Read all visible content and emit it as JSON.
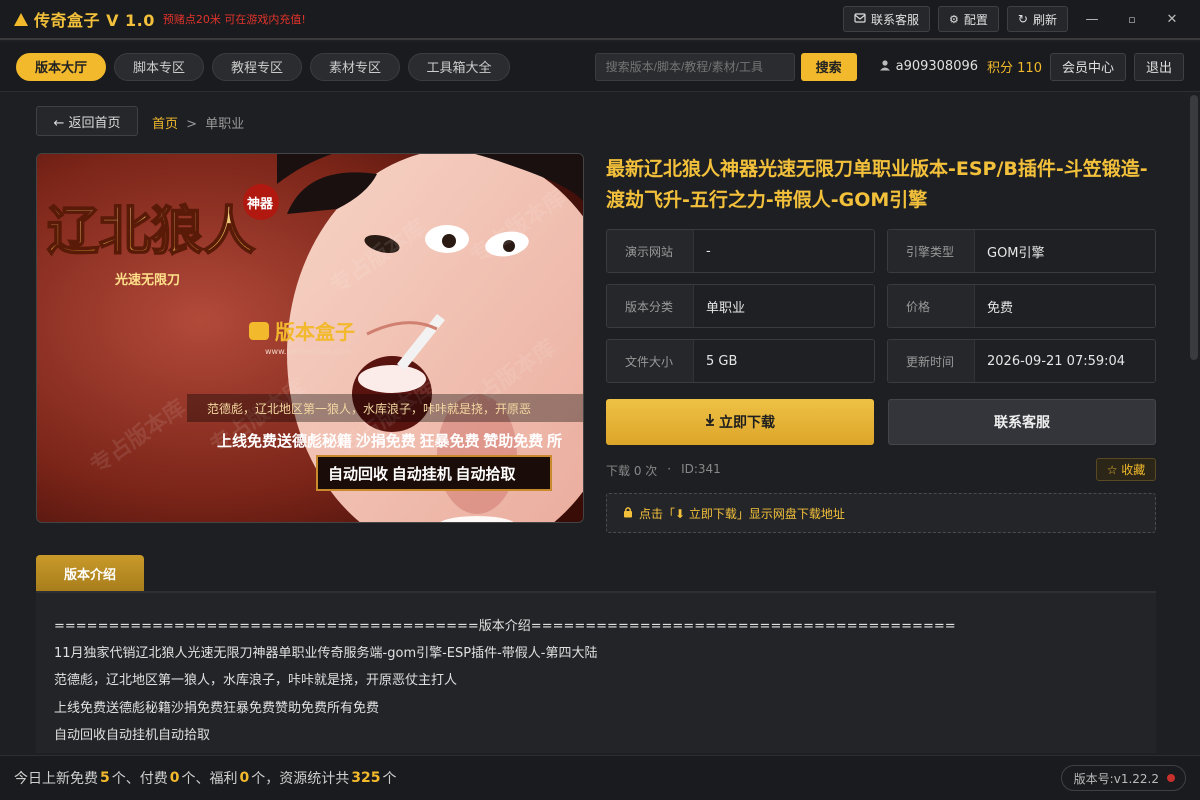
{
  "app": {
    "title": "传奇盒子 V 1.0",
    "notice": "预赌点20米 可在游戏内充值!",
    "buttons": {
      "service": "联系客服",
      "settings": "配置",
      "refresh": "刷新"
    },
    "minimize": "—",
    "maximize": "▫",
    "close": "✕"
  },
  "nav": {
    "tabs": [
      "版本大厅",
      "脚本专区",
      "教程专区",
      "素材专区",
      "工具箱大全"
    ],
    "active_tab": 0,
    "search_placeholder": "搜索版本/脚本/教程/素材/工具",
    "search_button": "搜索",
    "username": "a909308096",
    "points_label": "积分 110",
    "member_center": "会员中心",
    "logout": "退出"
  },
  "page": {
    "back_label": "← 返回首页",
    "breadcrumb_home": "首页",
    "breadcrumb_sep": ">",
    "breadcrumb_current": "单职业",
    "title": "最新辽北狼人神器光速无限刀单职业版本-ESP/B插件-斗笠锻造-渡劫飞升-五行之力-带假人-GOM引擎",
    "info": [
      {
        "key": "演示网站",
        "value": "-"
      },
      {
        "key": "引擎类型",
        "value": "GOM引擎"
      },
      {
        "key": "版本分类",
        "value": "单职业"
      },
      {
        "key": "价格",
        "value": "免费"
      },
      {
        "key": "文件大小",
        "value": "5 GB"
      },
      {
        "key": "更新时间",
        "value": "2026-09-21 07:59:04"
      }
    ],
    "download_button": "立即下载",
    "service_button": "联系客服",
    "downloads": "下载 0 次",
    "stats_sep": "·",
    "id_label": "ID:341",
    "favorite_button": "☆ 收藏",
    "download_notice": "点击「⬇ 立即下载」显示网盘下载地址",
    "section_tab": "版本介绍",
    "description": [
      "=======================================版本介绍=======================================",
      "11月独家代销辽北狼人光速无限刀神器单职业传奇服务端-gom引擎-ESP插件-带假人-第四大陆",
      "范德彪，辽北地区第一狼人，水库浪子，咔咔就是挠，开原恶仗主打人",
      "上线免费送德彪秘籍沙捐免费狂暴免费赞助免费所有免费",
      "自动回收自动挂机自动拾取"
    ]
  },
  "hero": {
    "logo_big": "辽北狼人",
    "logo_tag": "神器",
    "logo_sub": "光速无限刀",
    "brand": "版本盒子",
    "brand_url": "www.banbenbox.com",
    "line1": "范德彪，辽北地区第一狼人，水库浪子，咔咔就是挠，开原恶",
    "line2": "上线免费送德彪秘籍 沙捐免费 狂暴免费 赞助免费 所",
    "line3": "自动回收  自动挂机  自动拾取"
  },
  "footer": {
    "prefix": "今日上新免费",
    "free_count": "5",
    "t1": "个、付费",
    "paid_count": "0",
    "t2": "个、福利",
    "welfare_count": "0",
    "t3": "个，资源统计共",
    "total_count": "325",
    "t4": "个",
    "version": "版本号:v1.22.2"
  },
  "colors": {
    "accent": "#f2b92c",
    "background": "#1e1f23",
    "danger": "#e0332c"
  },
  "icons": [
    "logo-icon",
    "headset-icon",
    "gear-icon",
    "refresh-icon",
    "user-icon",
    "download-icon",
    "lock-icon",
    "star-icon"
  ]
}
